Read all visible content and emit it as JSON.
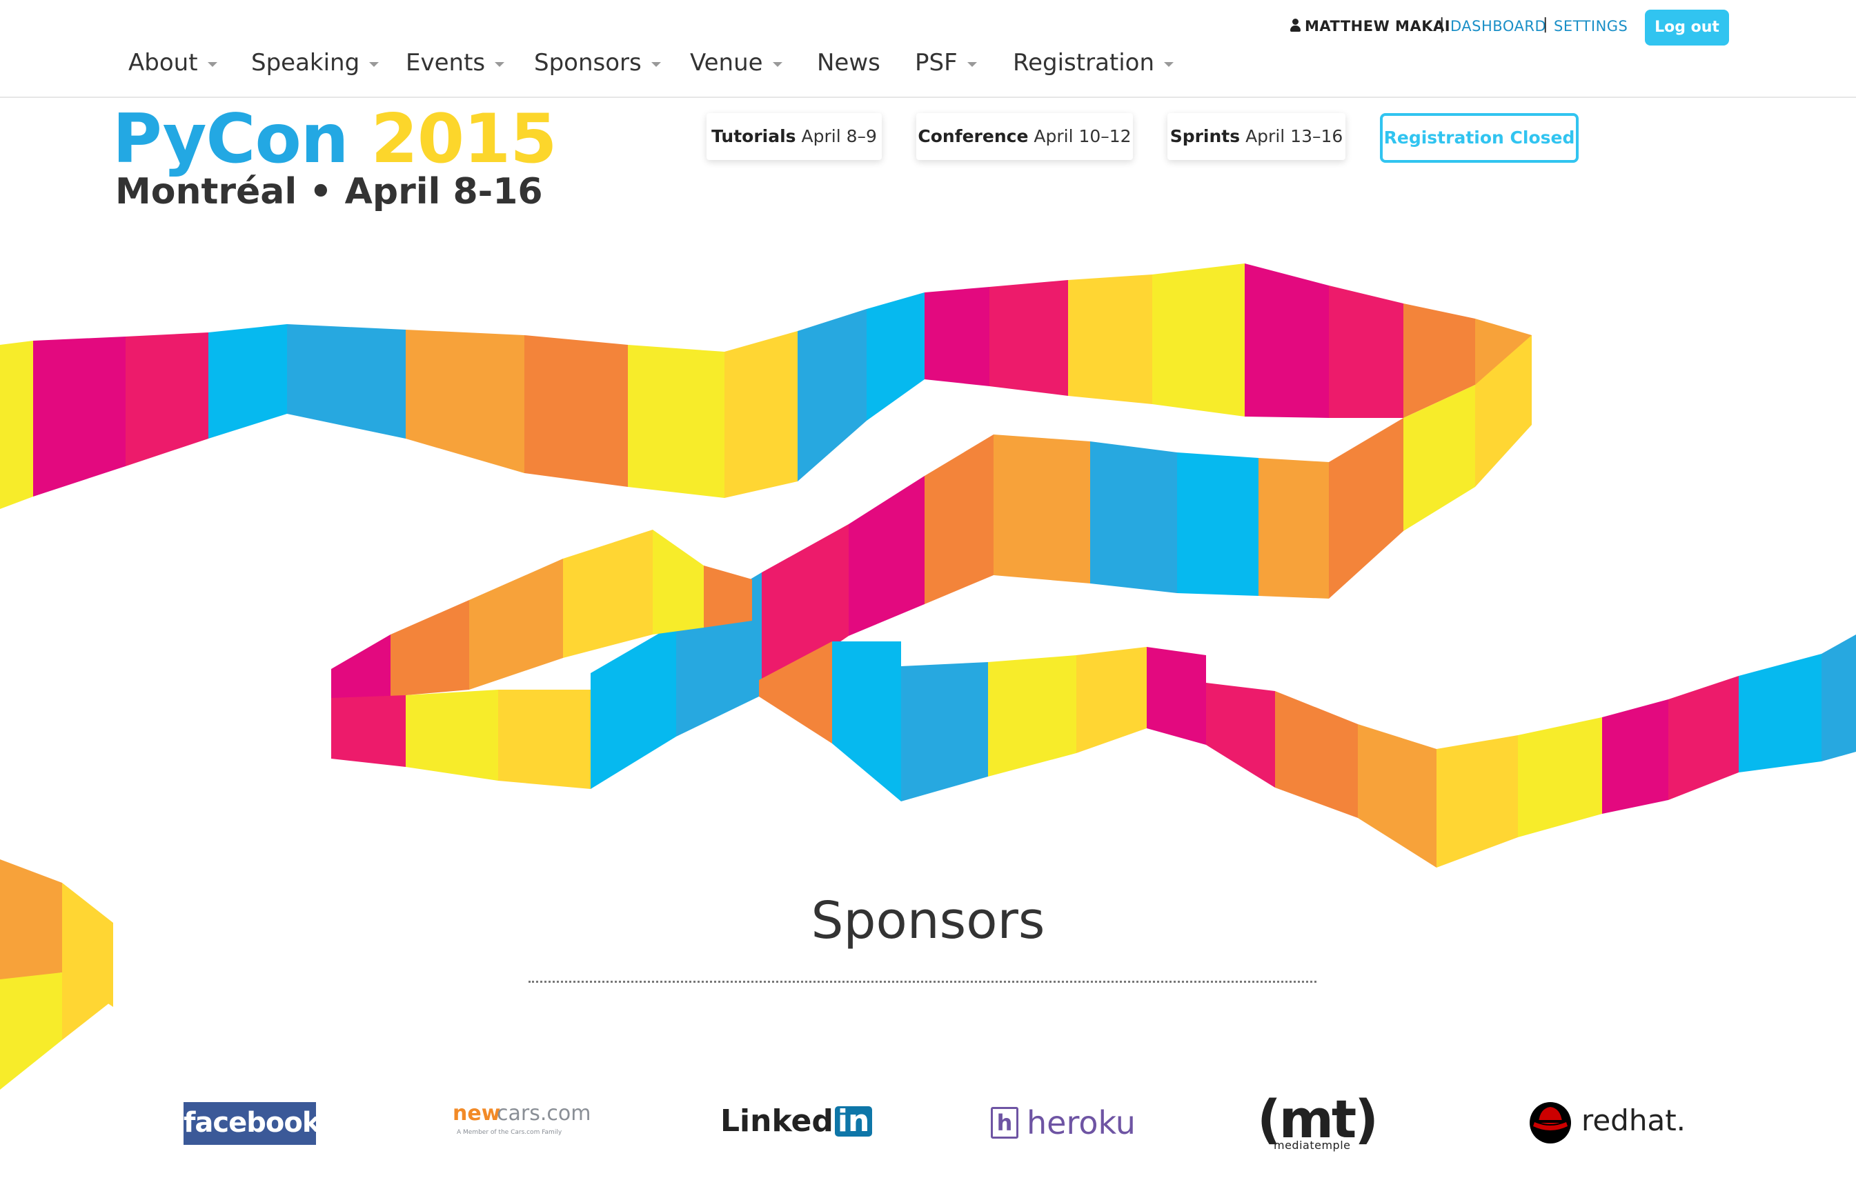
{
  "header": {
    "user": {
      "name": "MATTHEW MAKAI",
      "dashboard_label": "DASHBOARD",
      "settings_label": "SETTINGS",
      "separator": "|",
      "logout_label": "Log out"
    },
    "nav": [
      {
        "label": "About",
        "has_menu": true
      },
      {
        "label": "Speaking",
        "has_menu": true
      },
      {
        "label": "Events",
        "has_menu": true
      },
      {
        "label": "Sponsors",
        "has_menu": true
      },
      {
        "label": "Venue",
        "has_menu": true
      },
      {
        "label": "News",
        "has_menu": false
      },
      {
        "label": "PSF",
        "has_menu": true
      },
      {
        "label": "Registration",
        "has_menu": true
      }
    ]
  },
  "logo": {
    "name": "PyCon",
    "year": "2015",
    "subtitle": "Montréal • April 8-16"
  },
  "dates": [
    {
      "label": "Tutorials",
      "dates": "April 8–9"
    },
    {
      "label": "Conference",
      "dates": "April 10–12"
    },
    {
      "label": "Sprints",
      "dates": "April 13–16"
    }
  ],
  "registration_status": "Registration Closed",
  "sponsors": {
    "title": "Sponsors",
    "logos": [
      {
        "name": "facebook",
        "text": "facebook"
      },
      {
        "name": "newcars",
        "text_main": "new",
        "text_sub": "cars.com",
        "tagline": "A Member of the Cars.com Family"
      },
      {
        "name": "linkedin",
        "text_main": "Linked",
        "text_badge": "in"
      },
      {
        "name": "heroku",
        "glyph": "h",
        "text": "heroku"
      },
      {
        "name": "mediatemple",
        "text_main": "(mt)",
        "text_sub": "mediatemple"
      },
      {
        "name": "redhat",
        "text": "redhat."
      }
    ]
  },
  "colors": {
    "accent": "#31c4f0",
    "logo_blue": "#23a8e3",
    "logo_yellow": "#fcd62b",
    "link": "#1a8fc7",
    "ribbon": [
      "#f7ec2a",
      "#ffd633",
      "#f7a23a",
      "#f3843a",
      "#e3097f",
      "#ed1b6b",
      "#06b9ef",
      "#27a8e0"
    ]
  }
}
